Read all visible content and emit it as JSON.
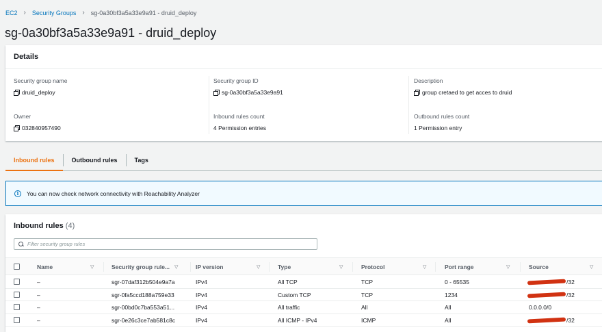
{
  "breadcrumb": {
    "items": [
      "EC2",
      "Security Groups",
      "sg-0a30bf3a5a33e9a91 - druid_deploy"
    ]
  },
  "page_title": "sg-0a30bf3a5a33e9a91 - druid_deploy",
  "details": {
    "header": "Details",
    "fields": {
      "sg_name": {
        "label": "Security group name",
        "value": "druid_deploy"
      },
      "sg_id": {
        "label": "Security group ID",
        "value": "sg-0a30bf3a5a33e9a91"
      },
      "description": {
        "label": "Description",
        "value": "group cretaed to get acces to druid"
      },
      "owner": {
        "label": "Owner",
        "value": "032840957490"
      },
      "inbound_count": {
        "label": "Inbound rules count",
        "value": "4 Permission entries"
      },
      "outbound_count": {
        "label": "Outbound rules count",
        "value": "1 Permission entry"
      }
    }
  },
  "tabs": [
    {
      "label": "Inbound rules",
      "active": true
    },
    {
      "label": "Outbound rules",
      "active": false
    },
    {
      "label": "Tags",
      "active": false
    }
  ],
  "alert": {
    "icon": "info-icon",
    "text": "You can now check network connectivity with Reachability Analyzer"
  },
  "inbound": {
    "title": "Inbound rules",
    "count": "(4)",
    "filter_placeholder": "Filter security group rules",
    "columns": [
      "Name",
      "Security group rule...",
      "IP version",
      "Type",
      "Protocol",
      "Port range",
      "Source"
    ],
    "rows": [
      {
        "name": "–",
        "rule_id": "sgr-07daf312b504e9a7a",
        "ip_version": "IPv4",
        "type": "All TCP",
        "protocol": "TCP",
        "port_range": "0 - 65535",
        "source": "/32",
        "source_redacted": true
      },
      {
        "name": "–",
        "rule_id": "sgr-0fa5ccd188a759e33",
        "ip_version": "IPv4",
        "type": "Custom TCP",
        "protocol": "TCP",
        "port_range": "1234",
        "source": "/32",
        "source_redacted": true
      },
      {
        "name": "–",
        "rule_id": "sgr-00bd0c7ba553a51...",
        "ip_version": "IPv4",
        "type": "All traffic",
        "protocol": "All",
        "port_range": "All",
        "source": "0.0.0.0/0",
        "source_redacted": false
      },
      {
        "name": "–",
        "rule_id": "sgr-0e26c3ce7ab581c8c",
        "ip_version": "IPv4",
        "type": "All ICMP - IPv4",
        "protocol": "ICMP",
        "port_range": "All",
        "source": "/32",
        "source_redacted": true
      }
    ]
  },
  "colors": {
    "accent": "#ec7211",
    "link": "#0073bb",
    "redaction": "#d13212"
  }
}
